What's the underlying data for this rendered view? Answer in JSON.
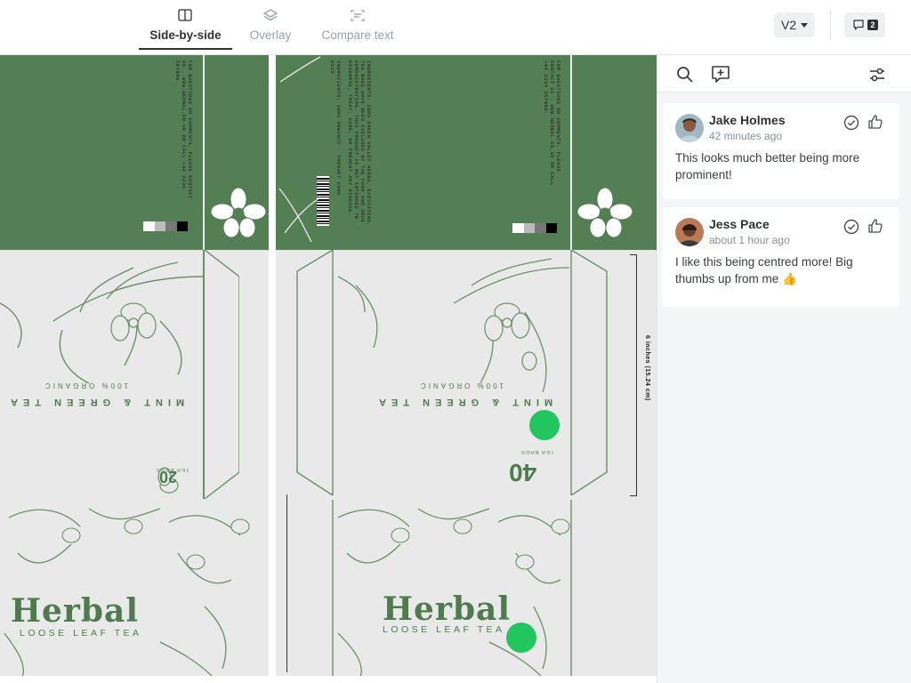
{
  "tabs": [
    {
      "label": "Side-by-side",
      "active": true
    },
    {
      "label": "Overlay",
      "active": false
    },
    {
      "label": "Compare text",
      "active": false
    }
  ],
  "version": {
    "label": "V2"
  },
  "comments_count": "2",
  "artwork": {
    "left": {
      "brand": "Herbal",
      "tagline": "LOOSE LEAF TEA",
      "flavor": "MINT & GREEN TEA",
      "organic": "100% ORGANIC",
      "count": "20",
      "count_label": "TEA BAGS"
    },
    "right": {
      "brand": "Herbal",
      "tagline": "LOOSE LEAF TEA",
      "flavor": "MINT & GREEN TEA",
      "organic": "100% ORGANIC",
      "count": "40",
      "count_label": "TEA BAGS",
      "dimension": "6 inches (15.24 cm)"
    }
  },
  "comments": [
    {
      "author": "Jake Holmes",
      "time": "42 minutes ago",
      "text": "This looks much better being more prominent!"
    },
    {
      "author": "Jess Pace",
      "time": "about 1 hour ago",
      "text": "I like this being centred more! Big thumbs up from me 👍"
    }
  ],
  "colors": {
    "package_green": "#547e53",
    "marker_green": "#22c55e"
  }
}
